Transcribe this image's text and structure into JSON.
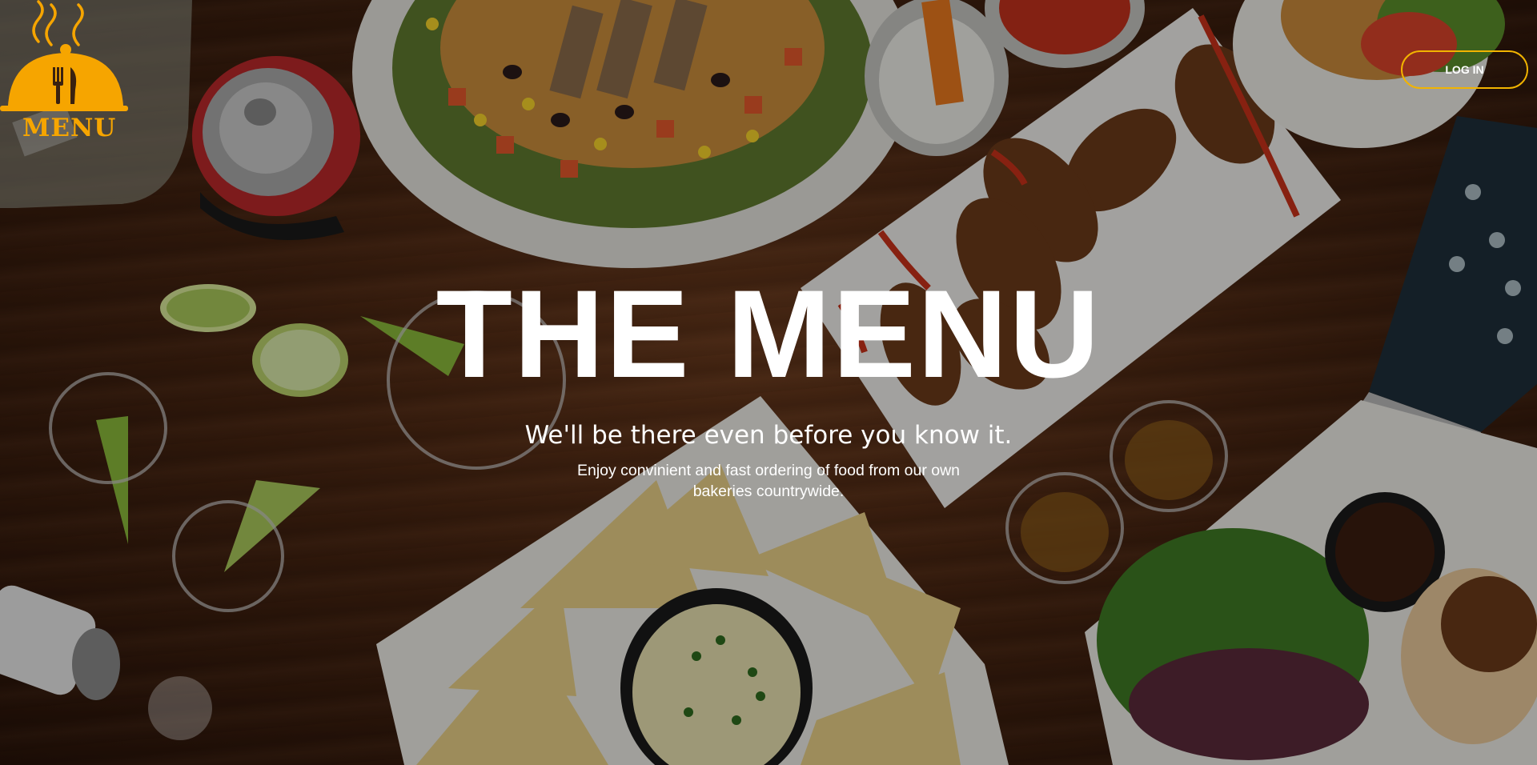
{
  "logo": {
    "text": "MENU",
    "icon": "cloche-fork-knife-icon",
    "color": "#f6a500"
  },
  "header": {
    "login_label": "LOG IN",
    "login_border_color": "#f2b400"
  },
  "hero": {
    "title": "THE MENU",
    "tagline": "We'll be there even before you know it.",
    "description": "Enjoy convinient and fast ordering of food from our own bakeries countrywide."
  }
}
